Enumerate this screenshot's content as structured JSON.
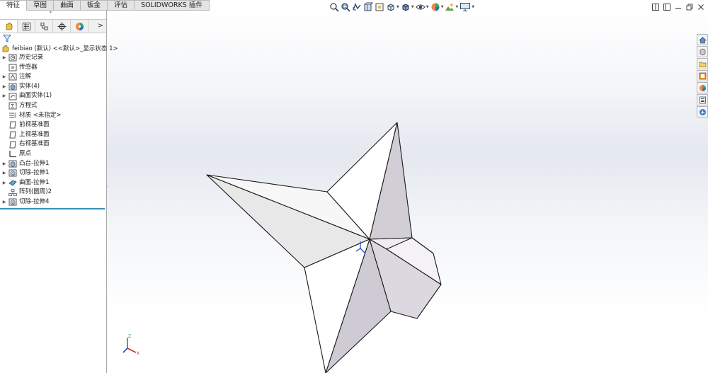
{
  "command_tabs": [
    "特征",
    "草图",
    "曲面",
    "钣金",
    "评估",
    "SOLIDWORKS 插件"
  ],
  "active_tab": "特征",
  "panel_tabs": [
    "feature-manager-icon",
    "property-manager-icon",
    "configuration-manager-icon",
    "dimxpert-manager-icon",
    "display-manager-icon"
  ],
  "panel_more": ">",
  "root_label": "feibiao (默认) <<默认>_显示状态 1>",
  "tree_items": [
    {
      "label": "历史记录",
      "icon": "history-icon",
      "expandable": true
    },
    {
      "label": "传感器",
      "icon": "sensor-icon",
      "expandable": false
    },
    {
      "label": "注解",
      "icon": "annotation-icon",
      "expandable": true
    },
    {
      "label": "实体(4)",
      "icon": "solid-body-icon",
      "expandable": true
    },
    {
      "label": "曲面实体(1)",
      "icon": "surface-body-icon",
      "expandable": true
    },
    {
      "label": "方程式",
      "icon": "equation-icon",
      "expandable": false
    },
    {
      "label": "材质 <未指定>",
      "icon": "material-icon",
      "expandable": false
    },
    {
      "label": "前视基准面",
      "icon": "plane-icon",
      "expandable": false
    },
    {
      "label": "上视基准面",
      "icon": "plane-icon",
      "expandable": false
    },
    {
      "label": "右视基准面",
      "icon": "plane-icon",
      "expandable": false
    },
    {
      "label": "原点",
      "icon": "origin-icon",
      "expandable": false
    },
    {
      "label": "凸台-拉伸1",
      "icon": "boss-extrude-icon",
      "expandable": true
    },
    {
      "label": "切除-拉伸1",
      "icon": "cut-extrude-icon",
      "expandable": true
    },
    {
      "label": "曲面-拉伸1",
      "icon": "surface-extrude-icon",
      "expandable": true
    },
    {
      "label": "阵列(圆周)2",
      "icon": "circular-pattern-icon",
      "expandable": false
    },
    {
      "label": "切除-拉伸4",
      "icon": "cut-extrude-icon",
      "expandable": true
    }
  ],
  "heads_up_toolbar": [
    "zoom-to-fit-icon",
    "zoom-to-area-icon",
    "previous-view-icon",
    "section-view-icon",
    "dynamic-annotation-icon",
    "view-orientation-icon",
    "display-style-icon",
    "hide-show-items-icon",
    "edit-appearance-icon",
    "apply-scene-icon",
    "view-settings-icon"
  ],
  "triad_axes": [
    "Z",
    "X"
  ],
  "colors": {
    "face_light": "#f2f2f2",
    "face_mid": "#e6e6e6",
    "face_dark": "#cdc9d0",
    "edge": "#1a1a1a",
    "rollback_bar": "#3a8fb7"
  }
}
